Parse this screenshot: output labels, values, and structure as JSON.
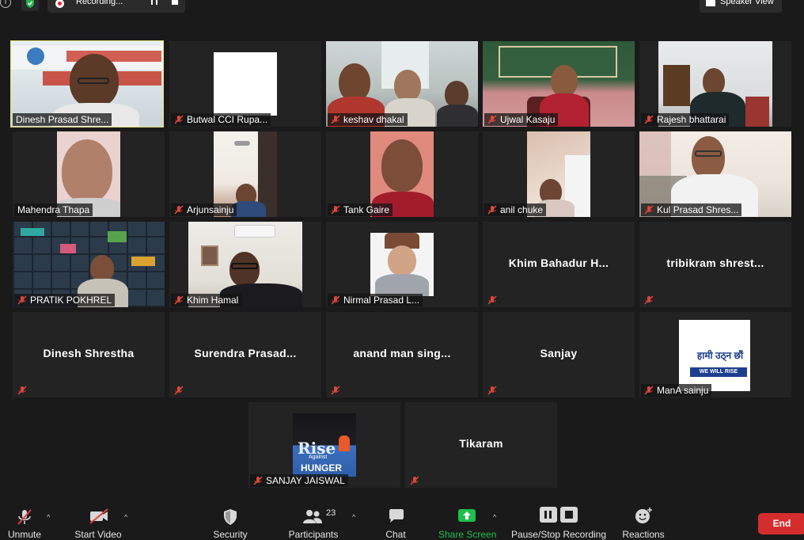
{
  "topbar": {
    "recording_label": "Recording...",
    "view_label": "Speaker View"
  },
  "participants": [
    {
      "name": "Dinesh Prasad Shre...",
      "muted": false,
      "video": true,
      "active": true
    },
    {
      "name": "Butwal CCI Rupa...",
      "muted": true,
      "video": true
    },
    {
      "name": "keshav dhakal",
      "muted": true,
      "video": true
    },
    {
      "name": "Ujwal Kasaju",
      "muted": true,
      "video": true
    },
    {
      "name": "Rajesh bhattarai",
      "muted": true,
      "video": true
    },
    {
      "name": "Mahendra Thapa",
      "muted": false,
      "video": true
    },
    {
      "name": "Arjunsainju",
      "muted": true,
      "video": true
    },
    {
      "name": "Tank Gaire",
      "muted": true,
      "video": true
    },
    {
      "name": "anil chuke",
      "muted": true,
      "video": true
    },
    {
      "name": "Kul Prasad Shres...",
      "muted": true,
      "video": true
    },
    {
      "name": "PRATIK POKHREL",
      "muted": true,
      "video": true
    },
    {
      "name": "Khim Hamal",
      "muted": true,
      "video": true
    },
    {
      "name": "Nirmal Prasad L...",
      "muted": true,
      "video": true
    },
    {
      "name": "Khim Bahadur H...",
      "muted": true,
      "video": false
    },
    {
      "name": "tribikram shrest...",
      "muted": true,
      "video": false
    },
    {
      "name": "Dinesh Shrestha",
      "muted": true,
      "video": false
    },
    {
      "name": "Surendra Prasad...",
      "muted": true,
      "video": false
    },
    {
      "name": "anand man sing...",
      "muted": true,
      "video": false
    },
    {
      "name": "Sanjay",
      "muted": true,
      "video": false
    },
    {
      "name": "ManA sainju",
      "muted": true,
      "video": true
    },
    {
      "name": "SANJAY JAISWAL",
      "muted": true,
      "video": true
    },
    {
      "name": "Tikaram",
      "muted": true,
      "video": false
    }
  ],
  "logos": {
    "mana_text": "हामी उठ्न छौं",
    "mana_sub": "WE WILL RISE",
    "rise_word": "Rise",
    "rise_against": "Against",
    "rise_hunger": "HUNGER"
  },
  "toolbar": {
    "unmute": "Unmute",
    "start_video": "Start Video",
    "security": "Security",
    "participants": "Participants",
    "participants_count": "23",
    "chat": "Chat",
    "share_screen": "Share Screen",
    "pause_stop": "Pause/Stop Recording",
    "reactions": "Reactions",
    "end": "End"
  },
  "colors": {
    "active_speaker_border": "#e6e27c",
    "share_green": "#1fbf4b",
    "end_red": "#d52d2d",
    "muted_red": "#e0453a"
  }
}
